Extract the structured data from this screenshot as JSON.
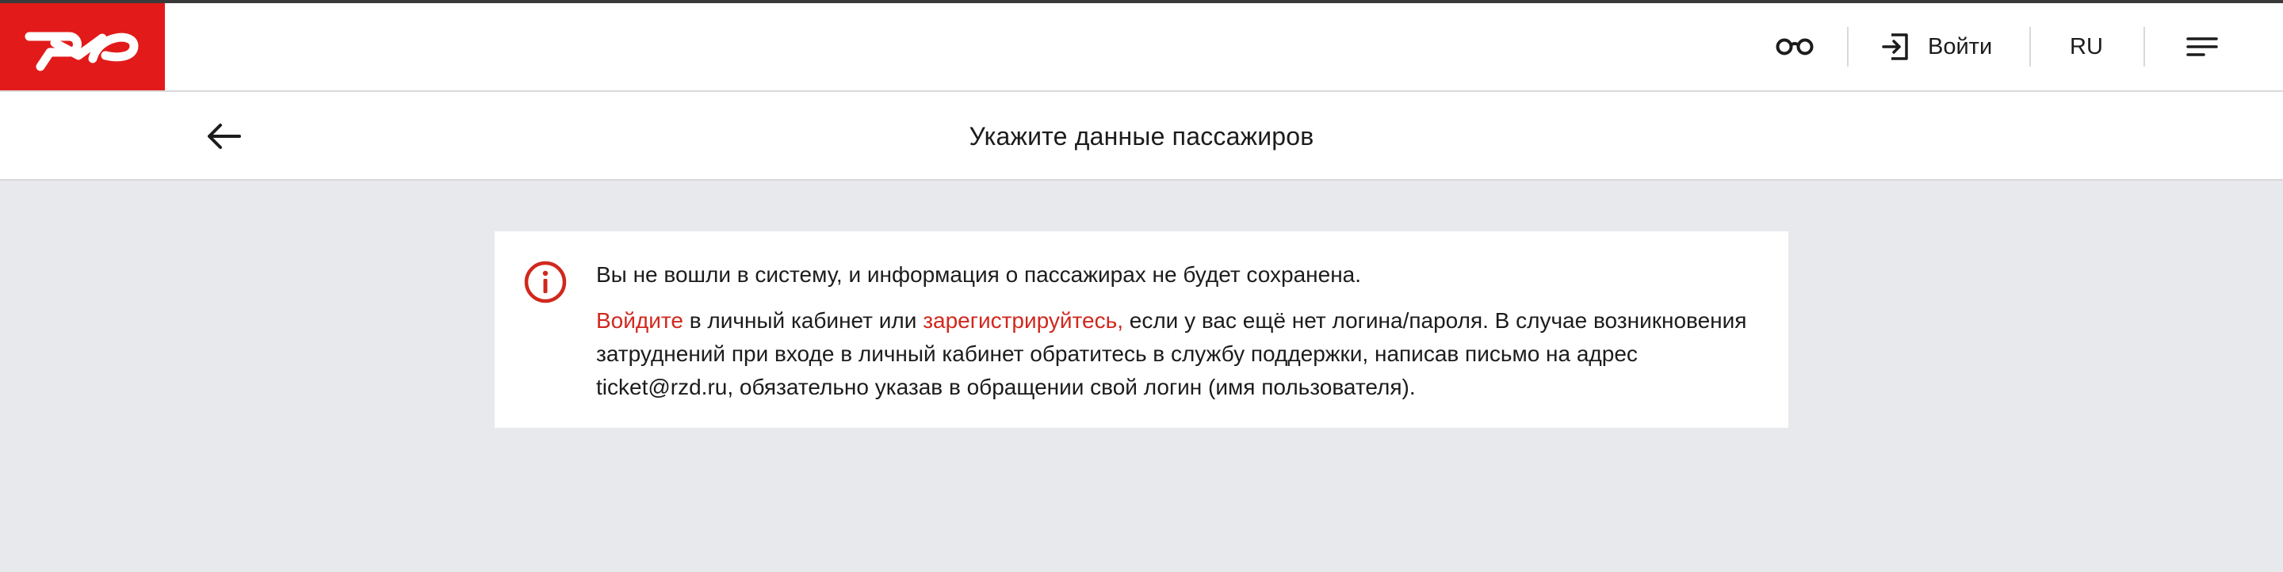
{
  "header": {
    "logo_alt": "РЖД",
    "accessibility_icon": "glasses-icon",
    "login_icon": "login-icon",
    "login_label": "Войти",
    "lang_label": "RU",
    "menu_icon": "menu-icon"
  },
  "titlebar": {
    "back_icon": "arrow-left-icon",
    "title": "Укажите данные пассажиров"
  },
  "notice": {
    "icon": "info-icon",
    "line1": "Вы не вошли в систему, и информация о пассажирах не будет сохранена.",
    "login_link": "Войдите",
    "text_a": " в личный кабинет или ",
    "register_link": "зарегистрируйтесь,",
    "text_b": " если у вас ещё нет логина/пароля. В случае возникновения затруднений при входе в личный кабинет обратитесь в службу поддержки, написав письмо на адрес ticket@rzd.ru, обязательно указав в обращении свой логин (имя пользователя)."
  },
  "colors": {
    "brand_red": "#e21a1a",
    "link_red": "#d0281e",
    "background": "#e8e9ed"
  }
}
